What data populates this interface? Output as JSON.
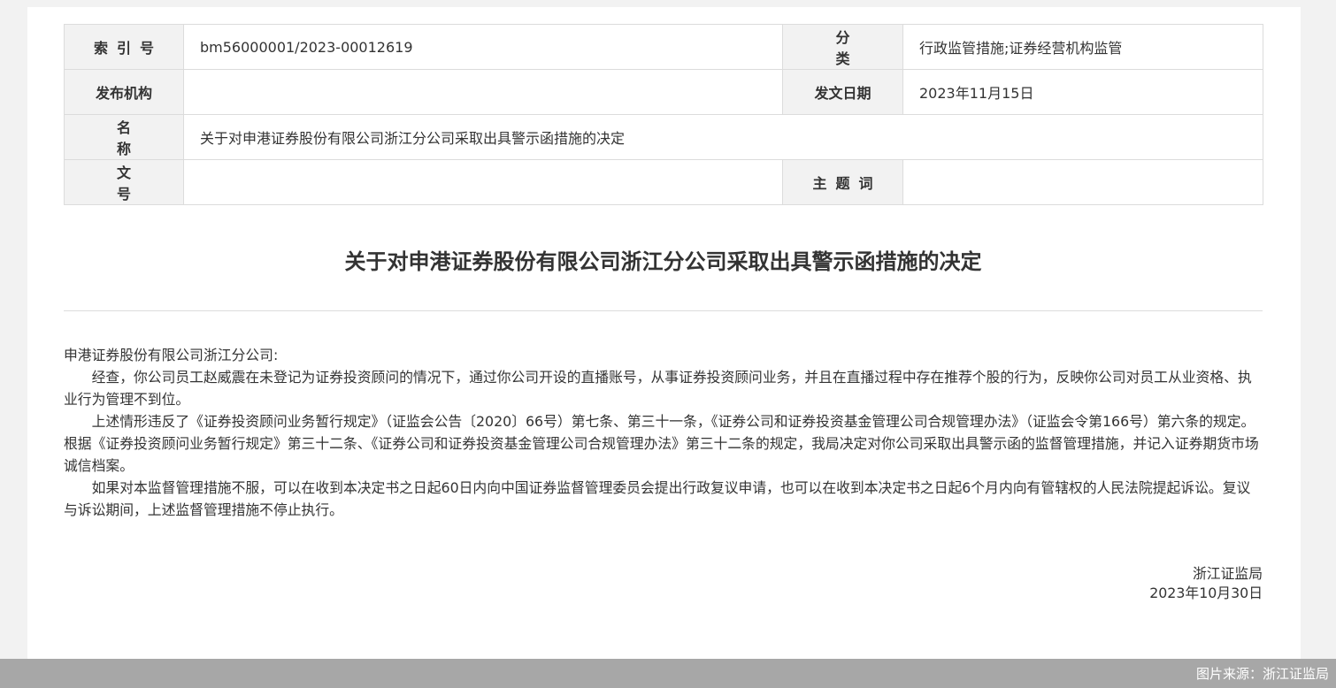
{
  "meta": {
    "index_label": "索引号",
    "index_value": "bm56000001/2023-00012619",
    "category_label": "分类",
    "category_value": "行政监管措施;证券经营机构监管",
    "publisher_label": "发布机构",
    "publisher_value": "",
    "date_label": "发文日期",
    "date_value": "2023年11月15日",
    "name_label": "名称",
    "name_value": "关于对申港证券股份有限公司浙江分公司采取出具警示函措施的决定",
    "docno_label": "文号",
    "docno_value": "",
    "keywords_label": "主题词",
    "keywords_value": ""
  },
  "document": {
    "title": "关于对申港证券股份有限公司浙江分公司采取出具警示函措施的决定",
    "salutation": "申港证券股份有限公司浙江分公司:",
    "paragraphs": [
      "经查，你公司员工赵威震在未登记为证券投资顾问的情况下，通过你公司开设的直播账号，从事证券投资顾问业务，并且在直播过程中存在推荐个股的行为，反映你公司对员工从业资格、执业行为管理不到位。",
      "上述情形违反了《证券投资顾问业务暂行规定》（证监会公告〔2020〕66号）第七条、第三十一条，《证券公司和证券投资基金管理公司合规管理办法》（证监会令第166号）第六条的规定。根据《证券投资顾问业务暂行规定》第三十二条、《证券公司和证券投资基金管理公司合规管理办法》第三十二条的规定，我局决定对你公司采取出具警示函的监督管理措施，并记入证券期货市场诚信档案。",
      "如果对本监督管理措施不服，可以在收到本决定书之日起60日内向中国证券监督管理委员会提出行政复议申请，也可以在收到本决定书之日起6个月内向有管辖权的人民法院提起诉讼。复议与诉讼期间，上述监督管理措施不停止执行。"
    ],
    "signer": "浙江证监局",
    "sign_date": "2023年10月30日"
  },
  "footer": {
    "credit": "图片来源：浙江证监局"
  }
}
